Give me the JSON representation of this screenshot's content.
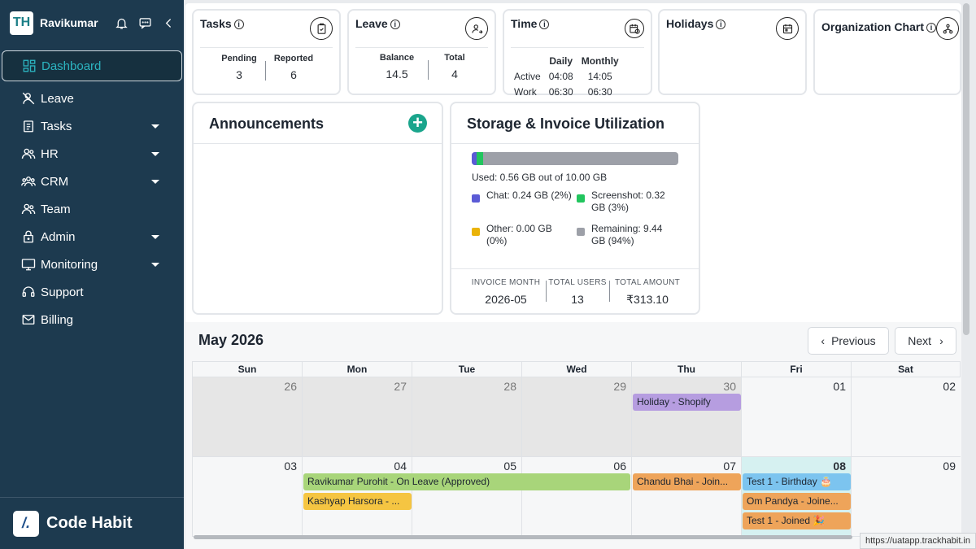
{
  "sidebar": {
    "user": "Ravikumar",
    "logo": "TH",
    "items": [
      {
        "label": "Dashboard"
      },
      {
        "label": "Leave"
      },
      {
        "label": "Tasks"
      },
      {
        "label": "HR"
      },
      {
        "label": "CRM"
      },
      {
        "label": "Team"
      },
      {
        "label": "Admin"
      },
      {
        "label": "Monitoring"
      },
      {
        "label": "Support"
      },
      {
        "label": "Billing"
      }
    ],
    "footer_logo": "/.",
    "footer_text": "Code Habit"
  },
  "cards": {
    "tasks": {
      "title": "Tasks",
      "pending_label": "Pending",
      "pending": "3",
      "reported_label": "Reported",
      "reported": "6"
    },
    "leave": {
      "title": "Leave",
      "balance_label": "Balance",
      "balance": "14.5",
      "total_label": "Total",
      "total": "4"
    },
    "time": {
      "title": "Time",
      "daily": "Daily",
      "monthly": "Monthly",
      "active": "Active",
      "active_daily": "04:08",
      "active_monthly": "14:05",
      "work": "Work",
      "work_daily": "06:30",
      "work_monthly": "06:30"
    },
    "holidays": {
      "title": "Holidays"
    },
    "org": {
      "title": "Organization Chart"
    }
  },
  "announcements": {
    "title": "Announcements",
    "add": "+"
  },
  "storage": {
    "title": "Storage & Invoice Utilization",
    "used": "Used: 0.56 GB out of 10.00 GB",
    "chat": "Chat: 0.24 GB (2%)",
    "screenshot": "Screenshot: 0.32 GB (3%)",
    "other": "Other: 0.00 GB (0%)",
    "remaining": "Remaining: 9.44 GB (94%)",
    "colors": {
      "chat": "#5b5bd6",
      "screenshot": "#22c55e",
      "other": "#eab308",
      "remaining": "#9da0a8"
    },
    "invoice_month_label": "INVOICE MONTH",
    "invoice_month": "2026-05",
    "total_users_label": "TOTAL USERS",
    "total_users": "13",
    "total_amount_label": "TOTAL AMOUNT",
    "total_amount": "₹313.10"
  },
  "calendar": {
    "title": "May 2026",
    "prev": "Previous",
    "next": "Next",
    "days": [
      "Sun",
      "Mon",
      "Tue",
      "Wed",
      "Thu",
      "Fri",
      "Sat"
    ],
    "week1": [
      "26",
      "27",
      "28",
      "29",
      "30",
      "01",
      "02"
    ],
    "week2": [
      "03",
      "04",
      "05",
      "06",
      "07",
      "08",
      "09"
    ],
    "events": {
      "holiday": "Holiday - Shopify",
      "leave": "Ravikumar Purohit - On Leave (Approved)",
      "kashyap": "Kashyap Harsora - ...",
      "chandu": "Chandu Bhai - Join...",
      "birthday": "Test 1 - Birthday 🎂",
      "om": "Om Pandya - Joine...",
      "joined": "Test 1 - Joined 🎉"
    }
  },
  "status_url": "https://uatapp.trackhabit.in"
}
